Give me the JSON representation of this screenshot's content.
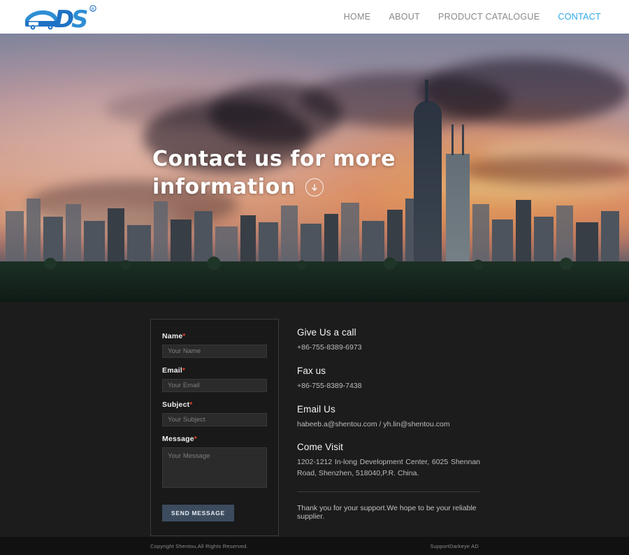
{
  "header": {
    "logo_text": "DS",
    "logo_tm": "®",
    "nav": [
      {
        "label": "HOME",
        "active": false
      },
      {
        "label": "ABOUT",
        "active": false
      },
      {
        "label": "PRODUCT CATALOGUE",
        "active": false
      },
      {
        "label": "CONTACT",
        "active": true
      }
    ],
    "accent_color": "#2aa8e8",
    "logo_color": "#1f72c4"
  },
  "hero": {
    "heading_line1": "Contact us for more",
    "heading_line2": "information",
    "scroll_icon": "arrow-down-circle-icon"
  },
  "form": {
    "fields": [
      {
        "label": "Name",
        "required": "*",
        "placeholder": "Your Name",
        "value": "",
        "type": "text"
      },
      {
        "label": "Email",
        "required": "*",
        "placeholder": "Your Email",
        "value": "",
        "type": "text"
      },
      {
        "label": "Subject",
        "required": "*",
        "placeholder": "Your Subject",
        "value": "",
        "type": "text"
      }
    ],
    "message": {
      "label": "Message",
      "required": "*",
      "placeholder": "Your Message",
      "value": ""
    },
    "submit_label": "SEND MESSAGE",
    "submit_color": "#3c4c5e",
    "required_color": "#e8412c"
  },
  "contact_info": {
    "blocks": [
      {
        "title": "Give Us a call",
        "text": "+86-755-8389-6973"
      },
      {
        "title": "Fax us",
        "text": "+86-755-8389-7438"
      },
      {
        "title": "Email Us",
        "text": "habeeb.a@shentou.com / yh.lin@shentou.com"
      },
      {
        "title": "Come Visit",
        "text": "1202-1212 In-long Development Center, 6025 Shennan Road, Shenzhen, 518040,P.R. China."
      }
    ],
    "thanks": "Thank you for your support.We hope to be your reliable supplier."
  },
  "footer": {
    "copyright": "Copyright Shentou,All Rights Reserved.",
    "support": "SupportDarkeye AD"
  }
}
